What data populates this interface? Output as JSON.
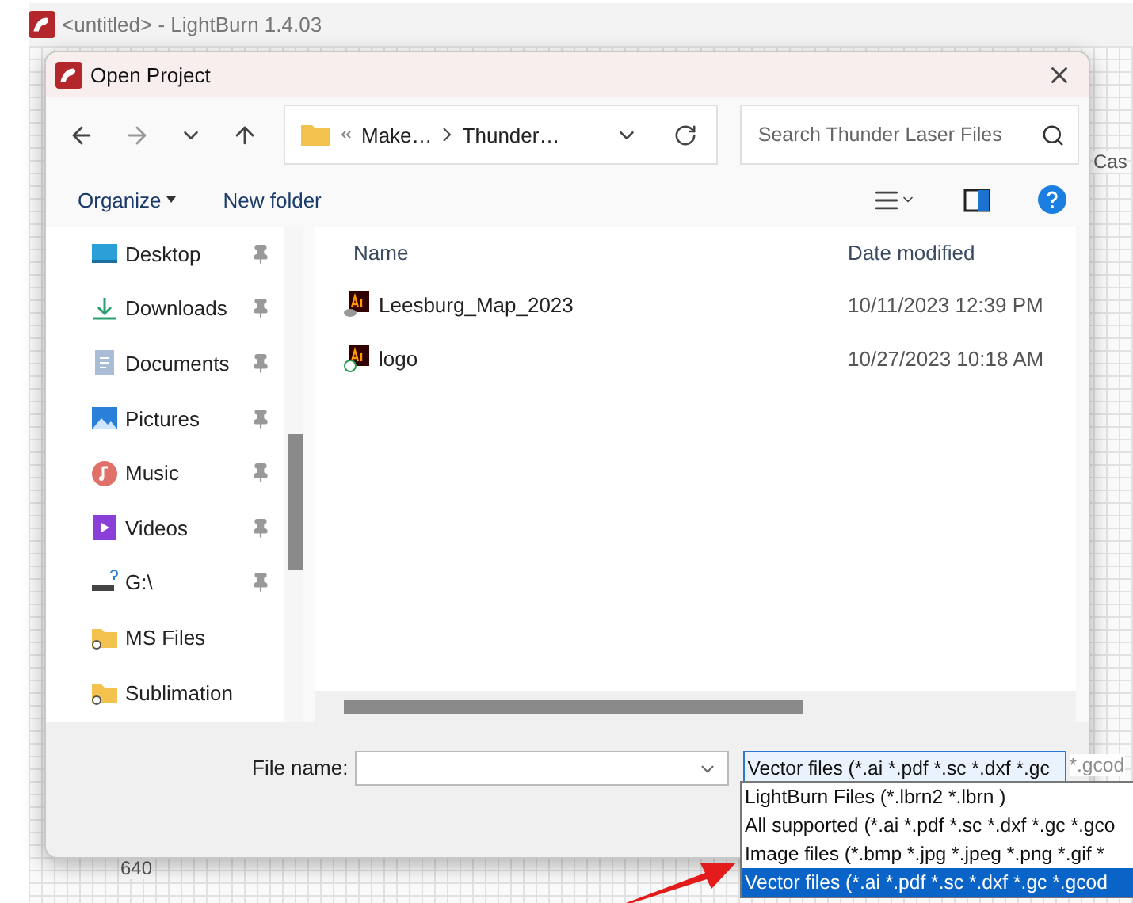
{
  "app_window": {
    "title": "<untitled> - LightBurn 1.4.03",
    "canvas_labels": [
      "Cas",
      "640"
    ]
  },
  "dialog": {
    "title": "Open Project",
    "address": {
      "crumbs": [
        "Make…",
        "Thunder…"
      ]
    },
    "search": {
      "placeholder": "Search Thunder Laser Files"
    },
    "toolbar": [
      "Organize",
      "New folder"
    ],
    "sidebar": [
      {
        "label": "Desktop",
        "kind": "desktop",
        "pinned": true
      },
      {
        "label": "Downloads",
        "kind": "downloads",
        "pinned": true
      },
      {
        "label": "Documents",
        "kind": "documents",
        "pinned": true
      },
      {
        "label": "Pictures",
        "kind": "pictures",
        "pinned": true
      },
      {
        "label": "Music",
        "kind": "music",
        "pinned": true
      },
      {
        "label": "Videos",
        "kind": "videos",
        "pinned": true
      },
      {
        "label": "G:\\",
        "kind": "drive",
        "pinned": true
      },
      {
        "label": "MS Files",
        "kind": "folder",
        "pinned": false
      },
      {
        "label": "Sublimation",
        "kind": "folder",
        "pinned": false
      }
    ],
    "columns": [
      "Name",
      "Date modified"
    ],
    "files": [
      {
        "name": "Leesburg_Map_2023",
        "date": "10/11/2023 12:39 PM",
        "synced": false
      },
      {
        "name": "logo",
        "date": "10/27/2023 10:18 AM",
        "synced": true
      }
    ],
    "file_name": {
      "label": "File name:"
    },
    "file_type": {
      "value": "Vector files (*.ai *.pdf *.sc *.dxf *.gc",
      "overflow": "*.gcod",
      "expanded": true,
      "options": [
        {
          "label": "LightBurn Files (*.lbrn2 *.lbrn )",
          "selected": false
        },
        {
          "label": "All supported (*.ai *.pdf *.sc *.dxf *.gc *.gco",
          "selected": false
        },
        {
          "label": "Image files (*.bmp *.jpg *.jpeg *.png *.gif *",
          "selected": false
        },
        {
          "label": "Vector files (*.ai *.pdf *.sc *.dxf *.gc *.gcod",
          "selected": true
        }
      ]
    }
  }
}
